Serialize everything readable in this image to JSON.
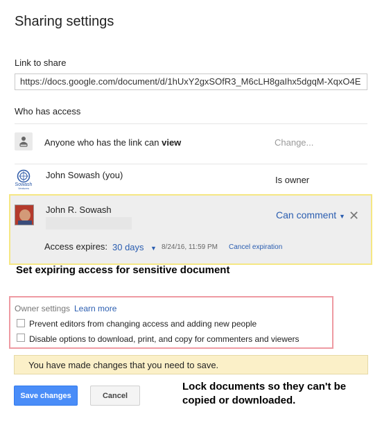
{
  "dialog": {
    "title": "Sharing settings",
    "link_label": "Link to share",
    "link_url": "https://docs.google.com/document/d/1hUxY2gxSOfR3_M6cLH8gaIhx5dgqM-XqxO4E",
    "access_label": "Who has access"
  },
  "access_rows": {
    "anyone": {
      "text_prefix": "Anyone who has the link can ",
      "text_bold": "view",
      "change_label": "Change...",
      "icon": "public-link-icon"
    },
    "owner": {
      "name": "John Sowash (you)",
      "role": "Is owner",
      "logo_text": "Sowash",
      "logo_subtext": "Ventures"
    },
    "commenter": {
      "name": "John R. Sowash",
      "role": "Can comment",
      "remove_icon": "close-icon",
      "expires_label": "Access expires:",
      "expires_value": "30 days",
      "expires_date": "8/24/16, 11:59 PM",
      "cancel_label": "Cancel expiration"
    }
  },
  "annotations": {
    "expiring_caption": "Set expiring access for sensitive document",
    "lock_caption_line1": "Lock documents so they can't be",
    "lock_caption_line2": "copied or downloaded."
  },
  "owner_settings": {
    "title": "Owner settings",
    "learn_more": "Learn more",
    "option1": "Prevent editors from changing access and adding new people",
    "option2": "Disable options to download, print, and copy for commenters and viewers",
    "option1_checked": false,
    "option2_checked": false
  },
  "footer": {
    "notice": "You have made changes that you need to save.",
    "save_label": "Save changes",
    "cancel_label": "Cancel"
  },
  "colors": {
    "link_blue": "#2a5db0",
    "save_blue": "#4a8df8",
    "highlight_yellow": "#f5e783",
    "highlight_red": "#ee9aa2",
    "notice_bg": "#fbf0c8"
  }
}
